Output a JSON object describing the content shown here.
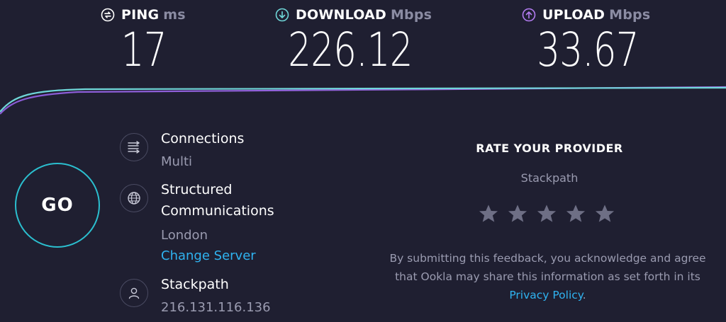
{
  "metrics": {
    "ping": {
      "label": "PING",
      "unit": "ms",
      "value": "17",
      "icon": "ping-icon"
    },
    "download": {
      "label": "DOWNLOAD",
      "unit": "Mbps",
      "value": "226.12",
      "icon": "download-arrow-icon"
    },
    "upload": {
      "label": "UPLOAD",
      "unit": "Mbps",
      "value": "33.67",
      "icon": "upload-arrow-icon"
    }
  },
  "colors": {
    "background": "#1f1f31",
    "download_line": "#6fd6d8",
    "upload_line": "#9b6ad8",
    "accent_cyan": "#2bbfcf",
    "link": "#2fb3f0",
    "muted_text": "#9a9bb0",
    "star": "#6e6f85"
  },
  "go_button": {
    "label": "GO"
  },
  "connections": {
    "title": "Connections",
    "value": "Multi",
    "icon": "connections-icon"
  },
  "server": {
    "name_line1": "Structured",
    "name_line2": "Communications",
    "location": "London",
    "change_label": "Change Server",
    "icon": "globe-icon"
  },
  "provider": {
    "name": "Stackpath",
    "ip": "216.131.116.136",
    "icon": "user-icon"
  },
  "rating": {
    "title": "RATE YOUR PROVIDER",
    "provider": "Stackpath",
    "stars_total": 5,
    "stars_selected": 0,
    "disclaimer_pre": "By submitting this feedback, you acknowledge and agree that Ookla may share this information as set forth in its ",
    "privacy_link": "Privacy Policy",
    "disclaimer_post": "."
  }
}
